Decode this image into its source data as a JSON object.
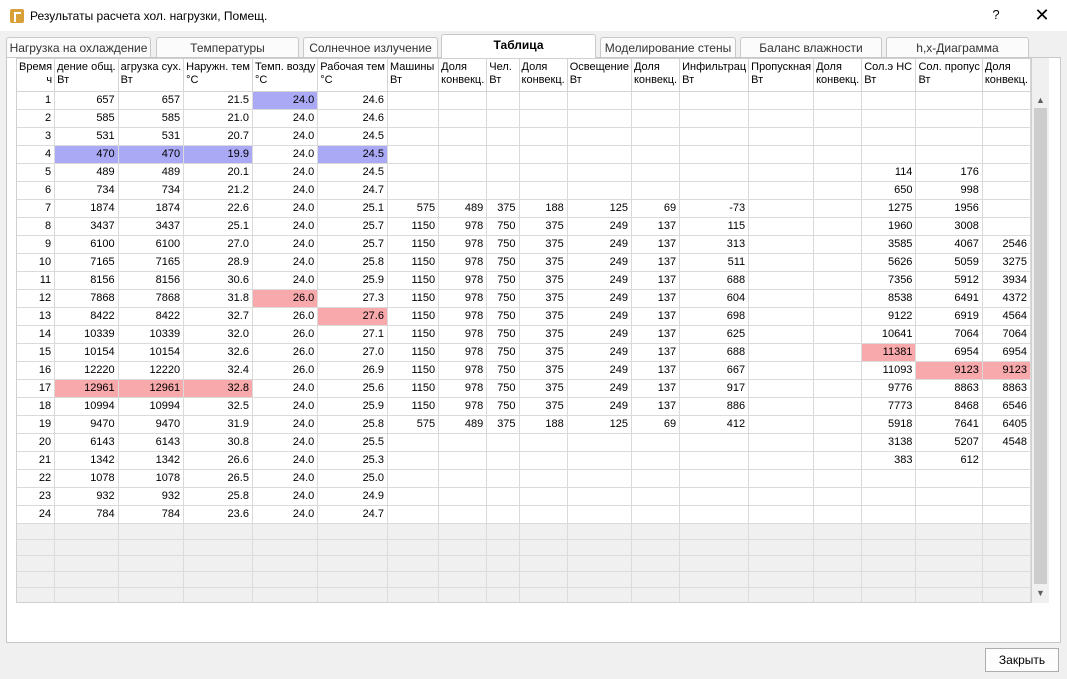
{
  "window": {
    "title": "Результаты расчета хол. нагрузки, Помещ.",
    "help_label": "?",
    "close_glyph": "✕",
    "app_icon": "app-logo-icon"
  },
  "tabs": [
    {
      "label": "Нагрузка на охлаждение",
      "active": false
    },
    {
      "label": "Температуры",
      "active": false
    },
    {
      "label": "Солнечное излучение",
      "active": false
    },
    {
      "label": "Таблица",
      "active": true
    },
    {
      "label": "Моделирование стены",
      "active": false
    },
    {
      "label": "Баланс влажности",
      "active": false
    },
    {
      "label": "h,x-Диаграмма",
      "active": false
    }
  ],
  "table": {
    "columns": [
      {
        "label": "Время",
        "unit": "ч"
      },
      {
        "label": "дение общ.",
        "unit": "Вт"
      },
      {
        "label": "агрузка сух.",
        "unit": "Вт"
      },
      {
        "label": "Наружн. тем",
        "unit": "°C"
      },
      {
        "label": "Темп. возду",
        "unit": "°C"
      },
      {
        "label": "Рабочая тем",
        "unit": "°C"
      },
      {
        "label": "Машины",
        "unit": "Вт"
      },
      {
        "label": "Доля",
        "unit": "конвекц."
      },
      {
        "label": "Чел.",
        "unit": "Вт"
      },
      {
        "label": "Доля",
        "unit": "конвекц."
      },
      {
        "label": "Освещение",
        "unit": "Вт"
      },
      {
        "label": "Доля",
        "unit": "конвекц."
      },
      {
        "label": "Инфильтрац",
        "unit": "Вт"
      },
      {
        "label": "Пропускная",
        "unit": "Вт"
      },
      {
        "label": "Доля",
        "unit": "конвекц."
      },
      {
        "label": "Сол.э НС",
        "unit": "Вт"
      },
      {
        "label": "Сол. пропус",
        "unit": "Вт"
      },
      {
        "label": "Доля",
        "unit": "конвекц."
      }
    ],
    "rows": [
      [
        "1",
        "657",
        "657",
        "21.5",
        "24.0",
        "24.6",
        "",
        "",
        "",
        "",
        "",
        "",
        "",
        "",
        "",
        "",
        "",
        ""
      ],
      [
        "2",
        "585",
        "585",
        "21.0",
        "24.0",
        "24.6",
        "",
        "",
        "",
        "",
        "",
        "",
        "",
        "",
        "",
        "",
        "",
        ""
      ],
      [
        "3",
        "531",
        "531",
        "20.7",
        "24.0",
        "24.5",
        "",
        "",
        "",
        "",
        "",
        "",
        "",
        "",
        "",
        "",
        "",
        ""
      ],
      [
        "4",
        "470",
        "470",
        "19.9",
        "24.0",
        "24.5",
        "",
        "",
        "",
        "",
        "",
        "",
        "",
        "",
        "",
        "",
        "",
        ""
      ],
      [
        "5",
        "489",
        "489",
        "20.1",
        "24.0",
        "24.5",
        "",
        "",
        "",
        "",
        "",
        "",
        "",
        "",
        "",
        "114",
        "176",
        ""
      ],
      [
        "6",
        "734",
        "734",
        "21.2",
        "24.0",
        "24.7",
        "",
        "",
        "",
        "",
        "",
        "",
        "",
        "",
        "",
        "650",
        "998",
        ""
      ],
      [
        "7",
        "1874",
        "1874",
        "22.6",
        "24.0",
        "25.1",
        "575",
        "489",
        "375",
        "188",
        "125",
        "69",
        "-73",
        "",
        "",
        "1275",
        "1956",
        ""
      ],
      [
        "8",
        "3437",
        "3437",
        "25.1",
        "24.0",
        "25.7",
        "1150",
        "978",
        "750",
        "375",
        "249",
        "137",
        "115",
        "",
        "",
        "1960",
        "3008",
        ""
      ],
      [
        "9",
        "6100",
        "6100",
        "27.0",
        "24.0",
        "25.7",
        "1150",
        "978",
        "750",
        "375",
        "249",
        "137",
        "313",
        "",
        "",
        "3585",
        "4067",
        "2546"
      ],
      [
        "10",
        "7165",
        "7165",
        "28.9",
        "24.0",
        "25.8",
        "1150",
        "978",
        "750",
        "375",
        "249",
        "137",
        "511",
        "",
        "",
        "5626",
        "5059",
        "3275"
      ],
      [
        "11",
        "8156",
        "8156",
        "30.6",
        "24.0",
        "25.9",
        "1150",
        "978",
        "750",
        "375",
        "249",
        "137",
        "688",
        "",
        "",
        "7356",
        "5912",
        "3934"
      ],
      [
        "12",
        "7868",
        "7868",
        "31.8",
        "26.0",
        "27.3",
        "1150",
        "978",
        "750",
        "375",
        "249",
        "137",
        "604",
        "",
        "",
        "8538",
        "6491",
        "4372"
      ],
      [
        "13",
        "8422",
        "8422",
        "32.7",
        "26.0",
        "27.6",
        "1150",
        "978",
        "750",
        "375",
        "249",
        "137",
        "698",
        "",
        "",
        "9122",
        "6919",
        "4564"
      ],
      [
        "14",
        "10339",
        "10339",
        "32.0",
        "26.0",
        "27.1",
        "1150",
        "978",
        "750",
        "375",
        "249",
        "137",
        "625",
        "",
        "",
        "10641",
        "7064",
        "7064"
      ],
      [
        "15",
        "10154",
        "10154",
        "32.6",
        "26.0",
        "27.0",
        "1150",
        "978",
        "750",
        "375",
        "249",
        "137",
        "688",
        "",
        "",
        "11381",
        "6954",
        "6954"
      ],
      [
        "16",
        "12220",
        "12220",
        "32.4",
        "26.0",
        "26.9",
        "1150",
        "978",
        "750",
        "375",
        "249",
        "137",
        "667",
        "",
        "",
        "11093",
        "9123",
        "9123"
      ],
      [
        "17",
        "12961",
        "12961",
        "32.8",
        "24.0",
        "25.6",
        "1150",
        "978",
        "750",
        "375",
        "249",
        "137",
        "917",
        "",
        "",
        "9776",
        "8863",
        "8863"
      ],
      [
        "18",
        "10994",
        "10994",
        "32.5",
        "24.0",
        "25.9",
        "1150",
        "978",
        "750",
        "375",
        "249",
        "137",
        "886",
        "",
        "",
        "7773",
        "8468",
        "6546"
      ],
      [
        "19",
        "9470",
        "9470",
        "31.9",
        "24.0",
        "25.8",
        "575",
        "489",
        "375",
        "188",
        "125",
        "69",
        "412",
        "",
        "",
        "5918",
        "7641",
        "6405"
      ],
      [
        "20",
        "6143",
        "6143",
        "30.8",
        "24.0",
        "25.5",
        "",
        "",
        "",
        "",
        "",
        "",
        "",
        "",
        "",
        "3138",
        "5207",
        "4548"
      ],
      [
        "21",
        "1342",
        "1342",
        "26.6",
        "24.0",
        "25.3",
        "",
        "",
        "",
        "",
        "",
        "",
        "",
        "",
        "",
        "383",
        "612",
        ""
      ],
      [
        "22",
        "1078",
        "1078",
        "26.5",
        "24.0",
        "25.0",
        "",
        "",
        "",
        "",
        "",
        "",
        "",
        "",
        "",
        "",
        "",
        ""
      ],
      [
        "23",
        "932",
        "932",
        "25.8",
        "24.0",
        "24.9",
        "",
        "",
        "",
        "",
        "",
        "",
        "",
        "",
        "",
        "",
        "",
        ""
      ],
      [
        "24",
        "784",
        "784",
        "23.6",
        "24.0",
        "24.7",
        "",
        "",
        "",
        "",
        "",
        "",
        "",
        "",
        "",
        "",
        "",
        ""
      ]
    ],
    "highlights": {
      "min_color": "#a9a9f5",
      "max_color": "#f7a9ab",
      "min_cells": [
        [
          0,
          4
        ],
        [
          3,
          1
        ],
        [
          3,
          2
        ],
        [
          3,
          3
        ],
        [
          3,
          5
        ]
      ],
      "max_cells": [
        [
          11,
          4
        ],
        [
          12,
          5
        ],
        [
          14,
          15
        ],
        [
          15,
          16
        ],
        [
          15,
          17
        ],
        [
          16,
          1
        ],
        [
          16,
          2
        ],
        [
          16,
          3
        ]
      ]
    }
  },
  "scrollbar": {
    "up_glyph": "▲",
    "down_glyph": "▼",
    "filter_glyph": "▾"
  },
  "footer": {
    "close_label": "Закрыть"
  }
}
